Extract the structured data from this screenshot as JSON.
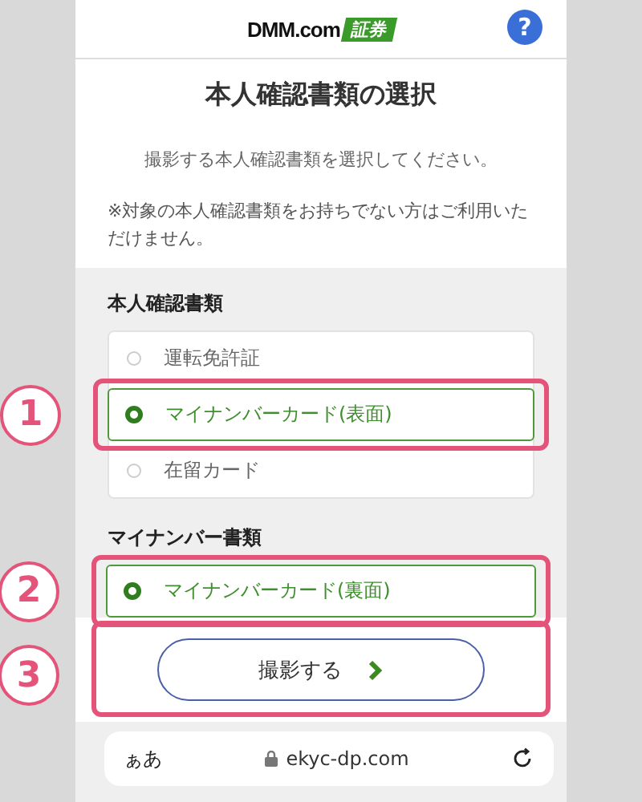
{
  "header": {
    "logo": {
      "brand": "DMM.com",
      "badge": "証券"
    },
    "help": "?"
  },
  "title": "本人確認書類の選択",
  "subtitle": "撮影する本人確認書類を選択してください。",
  "note": "※対象の本人確認書類をお持ちでない方はご利用いただけません。",
  "groups": [
    {
      "label": "本人確認書類",
      "items": [
        {
          "label": "運転免許証",
          "selected": false,
          "highlighted": false
        },
        {
          "label": "マイナンバーカード(表面)",
          "selected": true,
          "highlighted": true,
          "callout": "1"
        },
        {
          "label": "在留カード",
          "selected": false,
          "highlighted": false
        }
      ]
    },
    {
      "label": "マイナンバー書類",
      "items": [
        {
          "label": "マイナンバーカード(裏面)",
          "selected": true,
          "highlighted": true,
          "callout": "2"
        }
      ]
    }
  ],
  "action": {
    "label": "撮影する",
    "highlighted": true,
    "callout": "3"
  },
  "address_bar": {
    "text_size": "ぁあ",
    "url": "ekyc-dp.com"
  }
}
